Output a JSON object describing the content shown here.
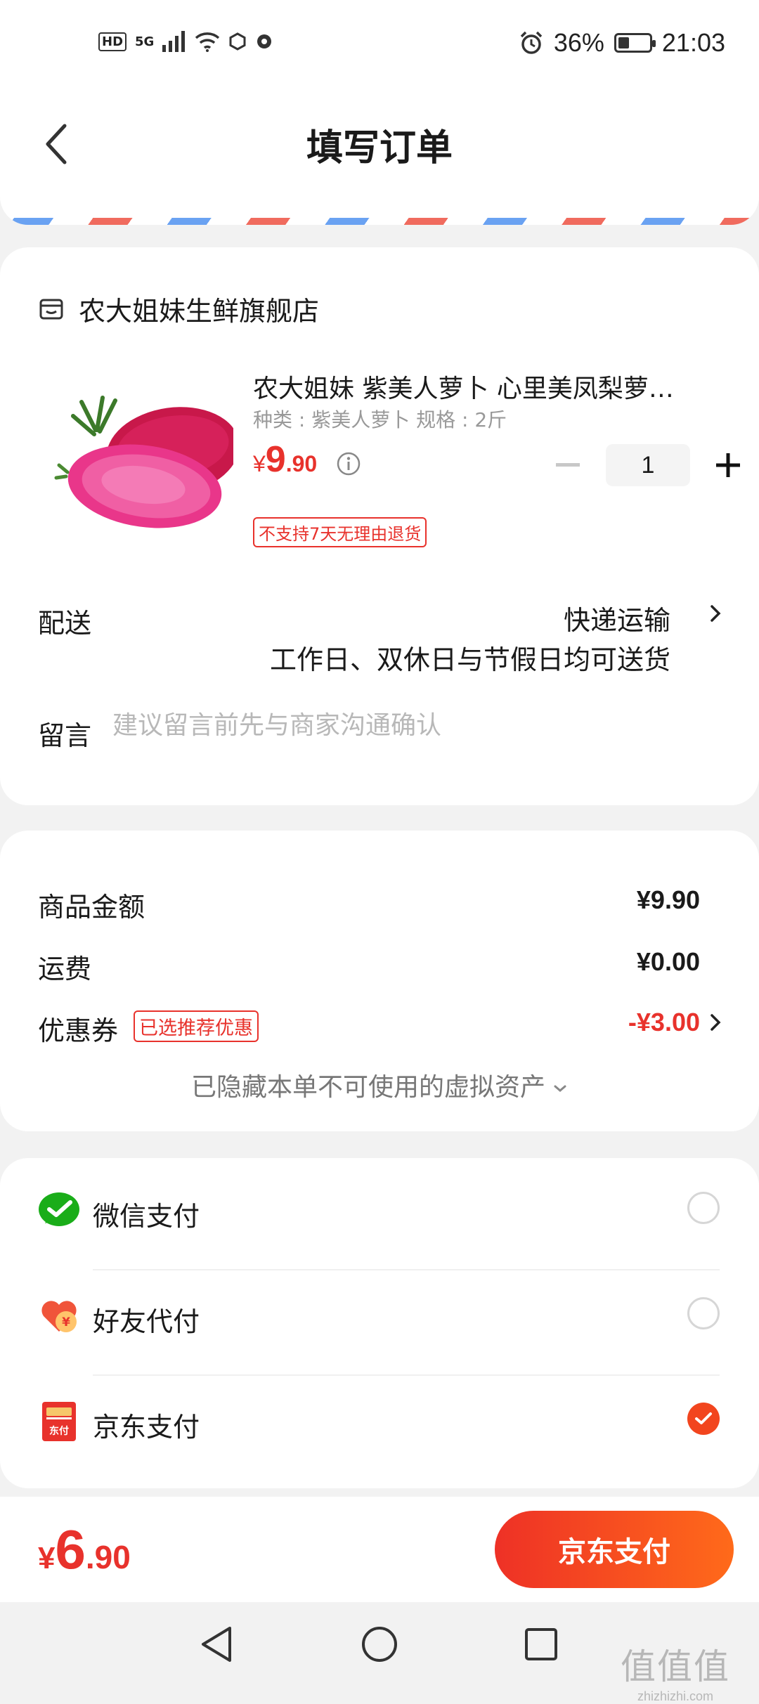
{
  "status_bar": {
    "hd": "HD",
    "net": "5G",
    "battery": "36%",
    "battery_level": 0.36,
    "time": "21:03"
  },
  "header": {
    "title": "填写订单"
  },
  "store": {
    "name": "农大姐妹生鲜旗舰店"
  },
  "product": {
    "title": "农大姐妹 紫美人萝卜 心里美凤梨萝…",
    "spec": "种类 : 紫美人萝卜    规格 : 2斤",
    "price_currency": "¥",
    "price_int": "9",
    "price_dec": ".90",
    "quantity": "1",
    "return_tag": "不支持7天无理由退货"
  },
  "delivery": {
    "label": "配送",
    "method": "快递运输",
    "note": "工作日、双休日与节假日均可送货"
  },
  "message": {
    "label": "留言",
    "placeholder": "建议留言前先与商家沟通确认",
    "value": ""
  },
  "amounts": {
    "goods_label": "商品金额",
    "goods_value": "¥9.90",
    "shipping_label": "运费",
    "shipping_value": "¥0.00",
    "coupon_label": "优惠券",
    "coupon_badge": "已选推荐优惠",
    "coupon_value": "-¥3.00",
    "hidden_assets": "已隐藏本单不可使用的虚拟资产"
  },
  "payment": {
    "methods": [
      {
        "label": "微信支付",
        "icon": "wechat-pay-icon",
        "selected": false
      },
      {
        "label": "好友代付",
        "icon": "friend-pay-icon",
        "selected": false
      },
      {
        "label": "京东支付",
        "icon": "jd-pay-icon",
        "selected": true
      }
    ]
  },
  "footer": {
    "total_currency": "¥",
    "total_int": "6",
    "total_dec": ".90",
    "pay_button": "京东支付"
  },
  "watermark": {
    "glyphs": "值值值",
    "url": "zhizhizhi.com"
  },
  "colors": {
    "accent_red": "#e8322c",
    "button_gradient_start": "#ee3126",
    "button_gradient_end": "#ff6a1a",
    "wechat_green": "#1aad19"
  }
}
